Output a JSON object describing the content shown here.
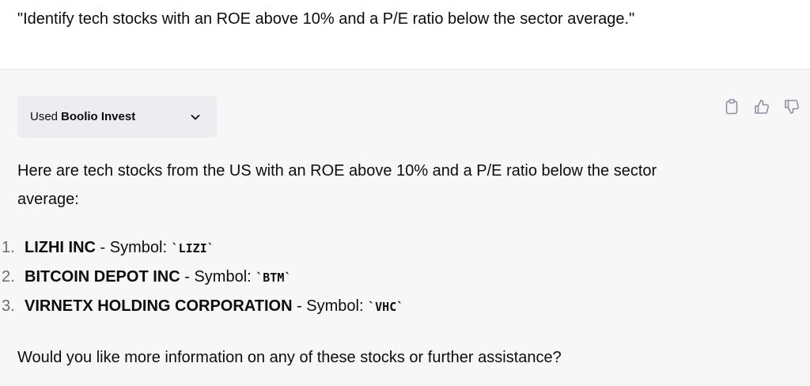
{
  "user_message": "\"Identify tech stocks with an ROE above 10% and a P/E ratio below the sector average.\"",
  "tool_call": {
    "used_label": "Used",
    "plugin_name": "Boolio Invest",
    "toggle_icon": "chevron-down-icon"
  },
  "actions": {
    "icons": [
      "clipboard-icon",
      "thumbs-up-icon",
      "thumbs-down-icon"
    ]
  },
  "response": {
    "intro": "Here are tech stocks from the US with an ROE above 10% and a P/E ratio below the sector average:",
    "stocks": [
      {
        "number": "1.",
        "name": "LIZHI INC",
        "separator": " - Symbol: ",
        "symbol": "`LIZI`"
      },
      {
        "number": "2.",
        "name": "BITCOIN DEPOT INC",
        "separator": " - Symbol: ",
        "symbol": "`BTM`"
      },
      {
        "number": "3.",
        "name": "VIRNETX HOLDING CORPORATION",
        "separator": " - Symbol: ",
        "symbol": "`VHC`"
      }
    ],
    "outro": "Would you like more information on any of these stocks or further assistance?"
  }
}
